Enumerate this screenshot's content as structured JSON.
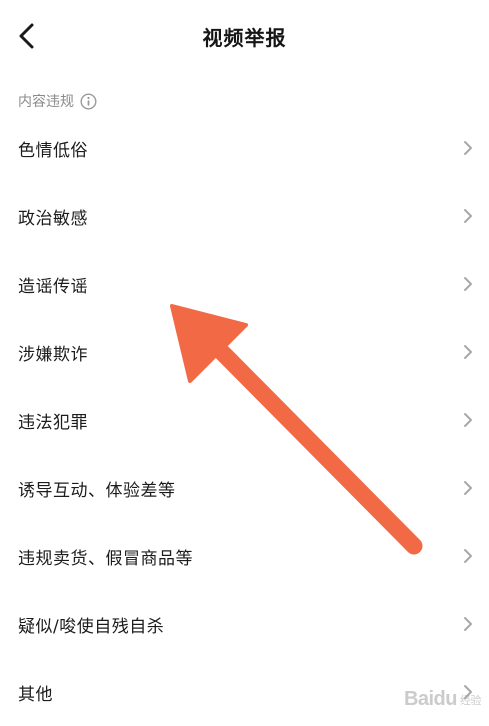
{
  "header": {
    "title": "视频举报",
    "back_icon": "chevron-left-icon"
  },
  "section": {
    "label": "内容违规",
    "info_icon": "info-circle-icon"
  },
  "items": [
    {
      "label": "色情低俗"
    },
    {
      "label": "政治敏感"
    },
    {
      "label": "造谣传谣"
    },
    {
      "label": "涉嫌欺诈"
    },
    {
      "label": "违法犯罪"
    },
    {
      "label": "诱导互动、体验差等"
    },
    {
      "label": "违规卖货、假冒商品等"
    },
    {
      "label": "疑似/唆使自残自杀"
    },
    {
      "label": "其他"
    }
  ],
  "watermark": {
    "text": "Baidu",
    "sub": "经验"
  },
  "colors": {
    "accent_arrow": "#f26a45",
    "secondary_text": "#8a8a8a",
    "chevron": "#a8a8a8"
  }
}
